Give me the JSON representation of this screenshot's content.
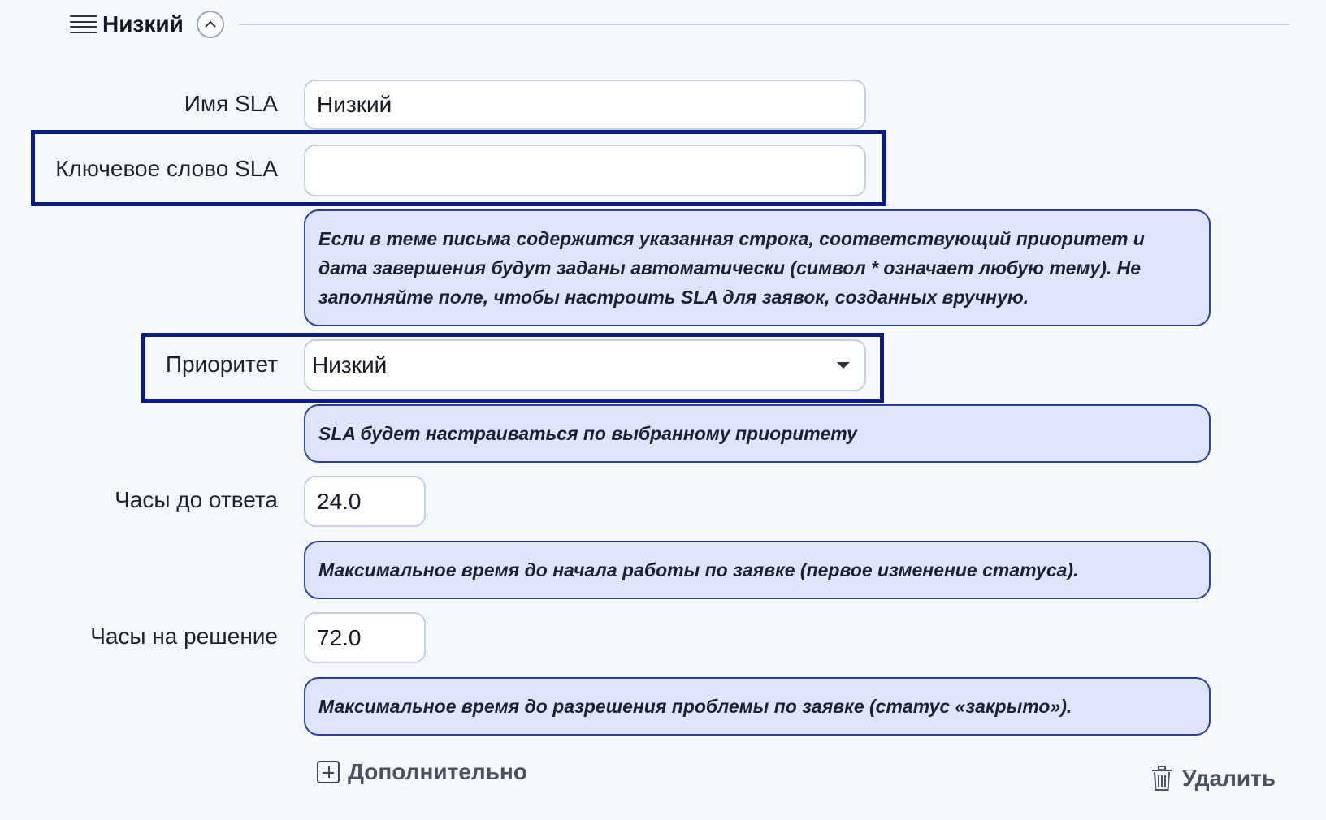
{
  "section": {
    "title": "Низкий"
  },
  "fields": {
    "sla_name": {
      "label": "Имя SLA",
      "value": "Низкий"
    },
    "sla_keyword": {
      "label": "Ключевое слово SLA",
      "value": ""
    },
    "priority": {
      "label": "Приоритет",
      "value": "Низкий"
    },
    "response_hours": {
      "label": "Часы до ответа",
      "value": "24.0"
    },
    "resolve_hours": {
      "label": "Часы на решение",
      "value": "72.0"
    }
  },
  "hints": {
    "keyword": "Если в теме письма содержится указанная строка, соответствующий приоритет и дата завершения будут заданы автоматически (символ * означает любую тему). Не заполняйте поле, чтобы настроить SLA для заявок, созданных вручную.",
    "priority": "SLA будет настраиваться по выбранному приоритету",
    "response": "Максимальное время до начала работы по заявке (первое изменение статуса).",
    "resolve": "Максимальное время до разрешения проблемы по заявке (статус «закрыто»)."
  },
  "actions": {
    "more_label": "Дополнительно",
    "delete_label": "Удалить"
  },
  "colors": {
    "hint_bg": "#dfe5fb",
    "hint_border": "#2b3f9c",
    "highlight": "#0a1a86"
  }
}
